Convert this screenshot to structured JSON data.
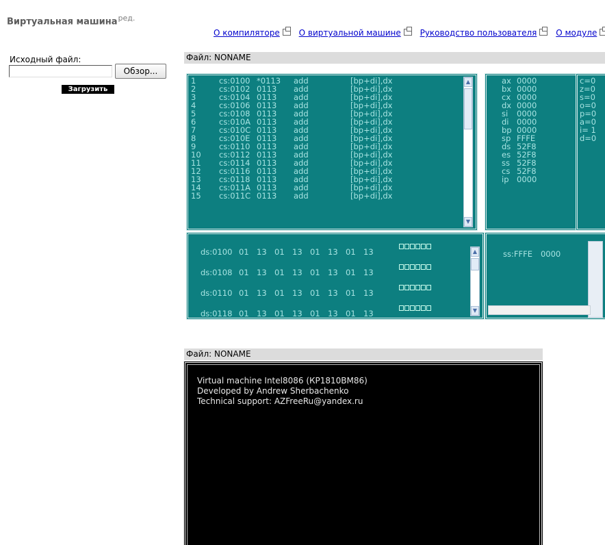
{
  "page": {
    "title": "Виртуальная машина",
    "title_sup": "ред."
  },
  "nav_links": [
    "О компиляторе",
    "О виртуальной машине",
    "Руководство пользователя",
    "О модуле"
  ],
  "upload_form": {
    "label": "Исходный файл:",
    "browse_label": "Обзор...",
    "upload_label": "Загрузить",
    "file_value": ""
  },
  "vm_panel": {
    "header": "Файл: NONAME",
    "code_rows": [
      {
        "n": "1",
        "addr": "cs:0100",
        "hex": "*0113",
        "mnem": "add",
        "ops": "[bp+di],dx"
      },
      {
        "n": "2",
        "addr": "cs:0102",
        "hex": "0113",
        "mnem": "add",
        "ops": "[bp+di],dx"
      },
      {
        "n": "3",
        "addr": "cs:0104",
        "hex": "0113",
        "mnem": "add",
        "ops": "[bp+di],dx"
      },
      {
        "n": "4",
        "addr": "cs:0106",
        "hex": "0113",
        "mnem": "add",
        "ops": "[bp+di],dx"
      },
      {
        "n": "5",
        "addr": "cs:0108",
        "hex": "0113",
        "mnem": "add",
        "ops": "[bp+di],dx"
      },
      {
        "n": "6",
        "addr": "cs:010A",
        "hex": "0113",
        "mnem": "add",
        "ops": "[bp+di],dx"
      },
      {
        "n": "7",
        "addr": "cs:010C",
        "hex": "0113",
        "mnem": "add",
        "ops": "[bp+di],dx"
      },
      {
        "n": "8",
        "addr": "cs:010E",
        "hex": "0113",
        "mnem": "add",
        "ops": "[bp+di],dx"
      },
      {
        "n": "9",
        "addr": "cs:0110",
        "hex": "0113",
        "mnem": "add",
        "ops": "[bp+di],dx"
      },
      {
        "n": "10",
        "addr": "cs:0112",
        "hex": "0113",
        "mnem": "add",
        "ops": "[bp+di],dx"
      },
      {
        "n": "11",
        "addr": "cs:0114",
        "hex": "0113",
        "mnem": "add",
        "ops": "[bp+di],dx"
      },
      {
        "n": "12",
        "addr": "cs:0116",
        "hex": "0113",
        "mnem": "add",
        "ops": "[bp+di],dx"
      },
      {
        "n": "13",
        "addr": "cs:0118",
        "hex": "0113",
        "mnem": "add",
        "ops": "[bp+di],dx"
      },
      {
        "n": "14",
        "addr": "cs:011A",
        "hex": "0113",
        "mnem": "add",
        "ops": "[bp+di],dx"
      },
      {
        "n": "15",
        "addr": "cs:011C",
        "hex": "0113",
        "mnem": "add",
        "ops": "[bp+di],dx"
      }
    ],
    "registers": [
      {
        "name": "ax",
        "value": "0000"
      },
      {
        "name": "bx",
        "value": "0000"
      },
      {
        "name": "cx",
        "value": "0000"
      },
      {
        "name": "dx",
        "value": "0000"
      },
      {
        "name": "si",
        "value": "0000"
      },
      {
        "name": "di",
        "value": "0000"
      },
      {
        "name": "bp",
        "value": "0000"
      },
      {
        "name": "sp",
        "value": "FFFE"
      },
      {
        "name": "ds",
        "value": "52F8"
      },
      {
        "name": "es",
        "value": "52F8"
      },
      {
        "name": "ss",
        "value": "52F8"
      },
      {
        "name": "cs",
        "value": "52F8"
      },
      {
        "name": "ip",
        "value": "0000"
      }
    ],
    "flags": [
      "c=0",
      "z=0",
      "s=0",
      "o=0",
      "p=0",
      "a=0",
      "i= 1",
      "d=0"
    ],
    "memory_rows": [
      {
        "addr": "ds:0100",
        "bytes": [
          "01",
          "13",
          "01",
          "13",
          "01",
          "13",
          "01",
          "13"
        ]
      },
      {
        "addr": "ds:0108",
        "bytes": [
          "01",
          "13",
          "01",
          "13",
          "01",
          "13",
          "01",
          "13"
        ]
      },
      {
        "addr": "ds:0110",
        "bytes": [
          "01",
          "13",
          "01",
          "13",
          "01",
          "13",
          "01",
          "13"
        ]
      },
      {
        "addr": "ds:0118",
        "bytes": [
          "01",
          "13",
          "01",
          "13",
          "01",
          "13",
          "01",
          "13"
        ]
      }
    ],
    "stack": {
      "addr": "ss:FFFE",
      "value": "0000"
    }
  },
  "console_panel": {
    "header": "Файл: NONAME",
    "lines": [
      "Virtual machine Intel8086 (КР1810ВМ86)",
      "Developed by Andrew Sherbachenko",
      "Technical support: AZFreeRu@yandex.ru"
    ]
  },
  "colors": {
    "teal_bg": "#0d7f80",
    "teal_text": "#a8e4e2",
    "link": "#0000cc",
    "console_bg": "#000000"
  }
}
